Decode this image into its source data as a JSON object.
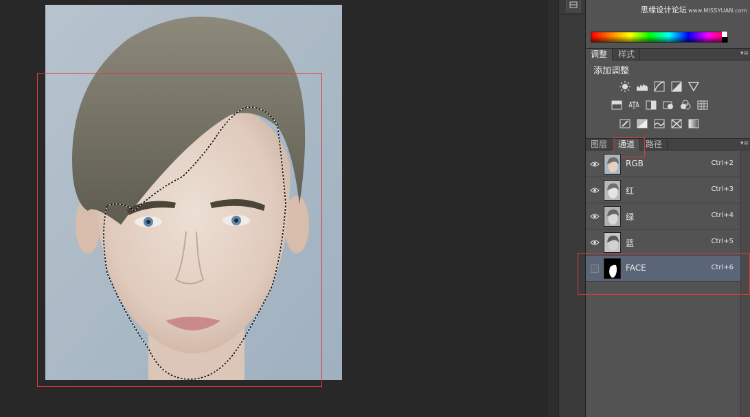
{
  "watermark": {
    "text": "思缘设计论坛",
    "site": "www.MISSYUAN.com"
  },
  "colors": {
    "panel_bg": "#535353",
    "canvas_bg": "#282828",
    "selection_highlight": "#5a6577",
    "annotation_red": "#e03a3a"
  },
  "adjust_tabs": [
    {
      "label": "调整",
      "active": true
    },
    {
      "label": "样式",
      "active": false
    }
  ],
  "adjust_panel": {
    "title": "添加调整",
    "rows": [
      [
        "brightness-contrast-icon",
        "levels-icon",
        "curves-icon",
        "exposure-icon",
        "vibrance-icon"
      ],
      [
        "hue-saturation-icon",
        "color-balance-icon",
        "black-white-icon",
        "photo-filter-icon",
        "channel-mixer-icon",
        "color-lookup-icon"
      ],
      [
        "invert-icon",
        "posterize-icon",
        "threshold-icon",
        "selective-color-icon",
        "gradient-map-icon"
      ]
    ]
  },
  "layer_tabs": [
    {
      "label": "图层",
      "active": false
    },
    {
      "label": "通道",
      "active": true
    },
    {
      "label": "路径",
      "active": false
    }
  ],
  "channels": [
    {
      "name": "RGB",
      "shortcut": "Ctrl+2",
      "visible": true,
      "selected": false,
      "thumb": "color"
    },
    {
      "name": "红",
      "shortcut": "Ctrl+3",
      "visible": true,
      "selected": false,
      "thumb": "gray"
    },
    {
      "name": "绿",
      "shortcut": "Ctrl+4",
      "visible": true,
      "selected": false,
      "thumb": "gray"
    },
    {
      "name": "蓝",
      "shortcut": "Ctrl+5",
      "visible": true,
      "selected": false,
      "thumb": "gray"
    },
    {
      "name": "FACE",
      "shortcut": "Ctrl+6",
      "visible": false,
      "selected": true,
      "thumb": "mask"
    }
  ]
}
